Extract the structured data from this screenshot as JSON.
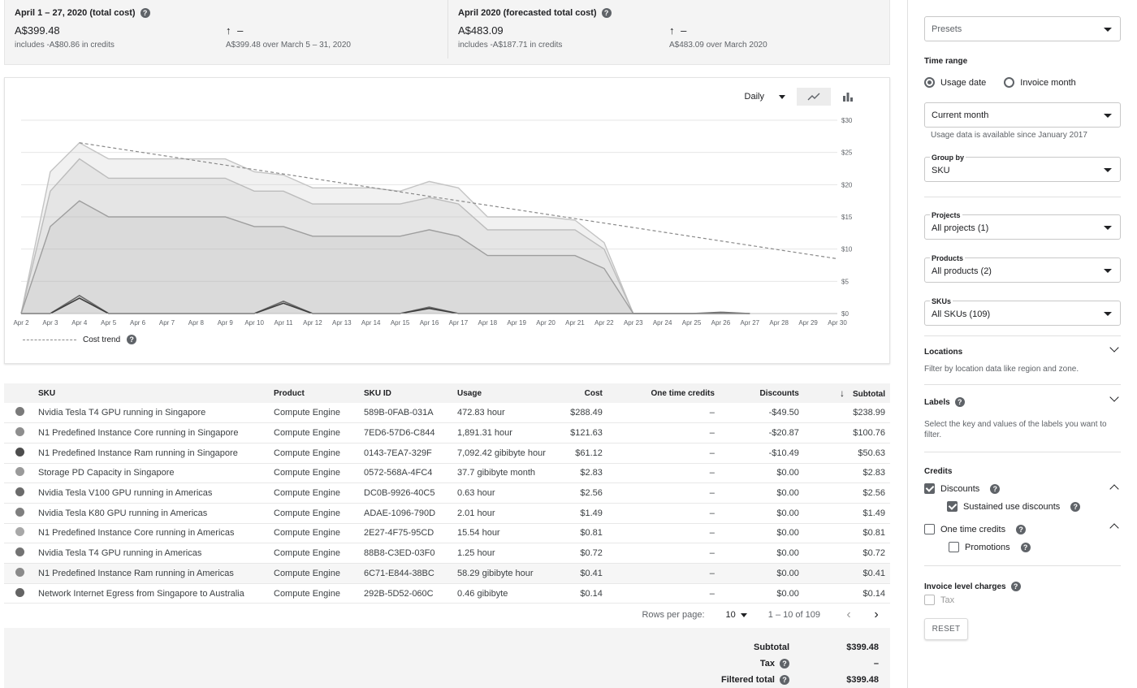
{
  "summary": {
    "left": {
      "title": "April 1 – 27, 2020 (total cost)",
      "value": "A$399.48",
      "credits": "includes -A$80.86 in credits",
      "change_symbol": "↑ –",
      "compare": "A$399.48 over March 5 – 31, 2020"
    },
    "right": {
      "title": "April 2020 (forecasted total cost)",
      "value": "A$483.09",
      "credits": "includes -A$187.71 in credits",
      "change_symbol": "↑ –",
      "compare": "A$483.09 over March 2020"
    }
  },
  "chart_controls": {
    "granularity": "Daily",
    "icons": {
      "line_view": "line-chart-icon",
      "bar_view": "bar-chart-icon"
    }
  },
  "chart_data": {
    "type": "area",
    "x": [
      "Apr 2",
      "Apr 3",
      "Apr 4",
      "Apr 5",
      "Apr 6",
      "Apr 7",
      "Apr 8",
      "Apr 9",
      "Apr 10",
      "Apr 11",
      "Apr 12",
      "Apr 13",
      "Apr 14",
      "Apr 15",
      "Apr 16",
      "Apr 17",
      "Apr 18",
      "Apr 19",
      "Apr 20",
      "Apr 21",
      "Apr 22",
      "Apr 23",
      "Apr 24",
      "Apr 25",
      "Apr 26",
      "Apr 27",
      "Apr 28",
      "Apr 29",
      "Apr 30"
    ],
    "y_ticks": [
      "$0",
      "$5",
      "$10",
      "$15",
      "$20",
      "$25",
      "$30"
    ],
    "ylim": [
      0,
      30
    ],
    "y_axis_side": "right",
    "grid": true,
    "legend": "bottom-left",
    "legend_entries": [
      "Cost trend"
    ],
    "series": [
      {
        "values": [
          0,
          22.0,
          26.5,
          24.0,
          24.0,
          24.0,
          24.0,
          24.0,
          22.0,
          21.5,
          19.5,
          19.5,
          19.5,
          19.0,
          20.5,
          19.5,
          15.0,
          15.0,
          15.0,
          14.5,
          11.0,
          0,
          0,
          0,
          0,
          0
        ]
      },
      {
        "values": [
          0,
          19.0,
          24.0,
          21.0,
          21.0,
          21.0,
          21.0,
          21.0,
          19.0,
          19.0,
          17.0,
          17.0,
          17.0,
          17.0,
          18.0,
          17.0,
          13.0,
          13.0,
          13.0,
          13.0,
          10.0,
          0,
          0,
          0,
          0,
          0
        ]
      },
      {
        "values": [
          0,
          13.5,
          17.5,
          15.0,
          15.0,
          15.0,
          15.0,
          15.0,
          13.5,
          13.5,
          12.0,
          12.0,
          12.0,
          12.0,
          13.0,
          12.0,
          9.0,
          9.0,
          9.0,
          9.0,
          7.0,
          0,
          0,
          0,
          0,
          0
        ]
      },
      {
        "values": [
          0,
          0,
          2.8,
          0,
          0,
          0,
          0,
          0,
          0,
          1.9,
          0,
          0,
          0,
          0,
          1.0,
          0,
          0,
          0,
          0,
          0,
          0,
          0,
          0,
          0,
          0.2,
          0
        ]
      },
      {
        "values": [
          0,
          0,
          2.4,
          0,
          0,
          0,
          0,
          0,
          0,
          1.6,
          0,
          0,
          0,
          0,
          0.8,
          0,
          0,
          0,
          0,
          0,
          0,
          0,
          0,
          0,
          0,
          0
        ]
      },
      {
        "name": "Cost trend",
        "style": "dashed",
        "x_range": [
          "Apr 4",
          "Apr 30"
        ],
        "values": [
          26.5,
          8.5
        ]
      }
    ]
  },
  "table": {
    "headers": {
      "sku": "SKU",
      "product": "Product",
      "sku_id": "SKU ID",
      "usage": "Usage",
      "cost": "Cost",
      "one_time_credits": "One time credits",
      "discounts": "Discounts",
      "subtotal": "Subtotal"
    },
    "sort_icon": "arrow-down-icon",
    "rows": [
      {
        "color": "#7a7a7a",
        "sku": "Nvidia Tesla T4 GPU running in Singapore",
        "product": "Compute Engine",
        "sku_id": "589B-0FAB-031A",
        "usage": "472.83 hour",
        "cost": "$288.49",
        "otc": "–",
        "discounts": "-$49.50",
        "subtotal": "$238.99"
      },
      {
        "color": "#8e8e8e",
        "sku": "N1 Predefined Instance Core running in Singapore",
        "product": "Compute Engine",
        "sku_id": "7ED6-57D6-C844",
        "usage": "1,891.31 hour",
        "cost": "$121.63",
        "otc": "–",
        "discounts": "-$20.87",
        "subtotal": "$100.76"
      },
      {
        "color": "#4d4d4d",
        "sku": "N1 Predefined Instance Ram running in Singapore",
        "product": "Compute Engine",
        "sku_id": "0143-7EA7-329F",
        "usage": "7,092.42 gibibyte hour",
        "cost": "$61.12",
        "otc": "–",
        "discounts": "-$10.49",
        "subtotal": "$50.63"
      },
      {
        "color": "#9a9a9a",
        "sku": "Storage PD Capacity in Singapore",
        "product": "Compute Engine",
        "sku_id": "0572-568A-4FC4",
        "usage": "37.7 gibibyte month",
        "cost": "$2.83",
        "otc": "–",
        "discounts": "$0.00",
        "subtotal": "$2.83"
      },
      {
        "color": "#6b6b6b",
        "sku": "Nvidia Tesla V100 GPU running in Americas",
        "product": "Compute Engine",
        "sku_id": "DC0B-9926-40C5",
        "usage": "0.63 hour",
        "cost": "$2.56",
        "otc": "–",
        "discounts": "$0.00",
        "subtotal": "$2.56"
      },
      {
        "color": "#7f7f7f",
        "sku": "Nvidia Tesla K80 GPU running in Americas",
        "product": "Compute Engine",
        "sku_id": "ADAE-1096-790D",
        "usage": "2.01 hour",
        "cost": "$1.49",
        "otc": "–",
        "discounts": "$0.00",
        "subtotal": "$1.49"
      },
      {
        "color": "#a8a8a8",
        "sku": "N1 Predefined Instance Core running in Americas",
        "product": "Compute Engine",
        "sku_id": "2E27-4F75-95CD",
        "usage": "15.54 hour",
        "cost": "$0.81",
        "otc": "–",
        "discounts": "$0.00",
        "subtotal": "$0.81"
      },
      {
        "color": "#737373",
        "sku": "Nvidia Tesla T4 GPU running in Americas",
        "product": "Compute Engine",
        "sku_id": "88B8-C3ED-03F0",
        "usage": "1.25 hour",
        "cost": "$0.72",
        "otc": "–",
        "discounts": "$0.00",
        "subtotal": "$0.72"
      },
      {
        "color": "#8a8a8a",
        "sku": "N1 Predefined Instance Ram running in Americas",
        "product": "Compute Engine",
        "sku_id": "6C71-E844-38BC",
        "usage": "58.29 gibibyte hour",
        "cost": "$0.41",
        "otc": "–",
        "discounts": "$0.00",
        "subtotal": "$0.41"
      },
      {
        "color": "#646464",
        "sku": "Network Internet Egress from Singapore to Australia",
        "product": "Compute Engine",
        "sku_id": "292B-5D52-060C",
        "usage": "0.46 gibibyte",
        "cost": "$0.14",
        "otc": "–",
        "discounts": "$0.00",
        "subtotal": "$0.14"
      }
    ]
  },
  "pagination": {
    "rows_per_page_label": "Rows per page:",
    "rows_per_page": "10",
    "range": "1 – 10 of 109",
    "prev_icon": "chevron-left-icon",
    "next_icon": "chevron-right-icon"
  },
  "totals": {
    "subtotal_label": "Subtotal",
    "subtotal": "$399.48",
    "tax_label": "Tax",
    "tax": "–",
    "filtered_label": "Filtered total",
    "filtered": "$399.48"
  },
  "sidebar": {
    "presets": "Presets",
    "time_range": {
      "heading": "Time range",
      "usage_date": "Usage date",
      "invoice_month": "Invoice month",
      "selected": "usage_date",
      "period": "Current month",
      "hint": "Usage data is available since January 2017"
    },
    "group_by": {
      "label": "Group by",
      "value": "SKU"
    },
    "projects": {
      "label": "Projects",
      "value": "All projects (1)"
    },
    "products": {
      "label": "Products",
      "value": "All products (2)"
    },
    "skus": {
      "label": "SKUs",
      "value": "All SKUs (109)"
    },
    "locations": {
      "heading": "Locations",
      "hint": "Filter by location data like region and zone."
    },
    "labels": {
      "heading": "Labels",
      "hint": "Select the key and values of the labels you want to filter."
    },
    "credits": {
      "heading": "Credits",
      "discounts": "Discounts",
      "sustained": "Sustained use discounts",
      "one_time": "One time credits",
      "promotions": "Promotions"
    },
    "invoice": {
      "heading": "Invoice level charges",
      "tax": "Tax"
    },
    "reset": "RESET"
  }
}
